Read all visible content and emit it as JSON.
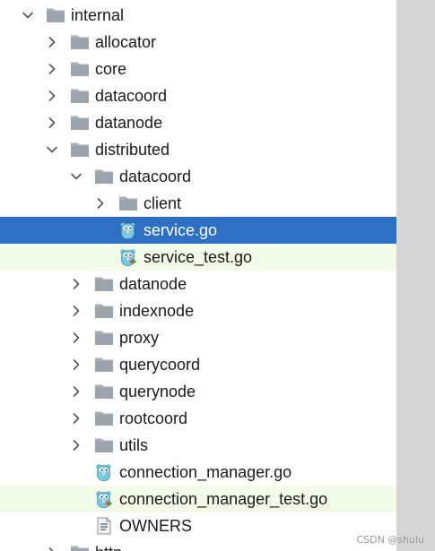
{
  "tree": {
    "items": [
      {
        "label": "internal",
        "type": "folder",
        "depth": 0,
        "expanded": true
      },
      {
        "label": "allocator",
        "type": "folder",
        "depth": 1,
        "expanded": false
      },
      {
        "label": "core",
        "type": "folder",
        "depth": 1,
        "expanded": false
      },
      {
        "label": "datacoord",
        "type": "folder",
        "depth": 1,
        "expanded": false
      },
      {
        "label": "datanode",
        "type": "folder",
        "depth": 1,
        "expanded": false
      },
      {
        "label": "distributed",
        "type": "folder",
        "depth": 1,
        "expanded": true
      },
      {
        "label": "datacoord",
        "type": "folder",
        "depth": 2,
        "expanded": true
      },
      {
        "label": "client",
        "type": "folder",
        "depth": 3,
        "expanded": false
      },
      {
        "label": "service.go",
        "type": "go-file",
        "depth": 3,
        "state": "selected"
      },
      {
        "label": "service_test.go",
        "type": "go-test-file",
        "depth": 3,
        "state": "highlight"
      },
      {
        "label": "datanode",
        "type": "folder",
        "depth": 2,
        "expanded": false
      },
      {
        "label": "indexnode",
        "type": "folder",
        "depth": 2,
        "expanded": false
      },
      {
        "label": "proxy",
        "type": "folder",
        "depth": 2,
        "expanded": false
      },
      {
        "label": "querycoord",
        "type": "folder",
        "depth": 2,
        "expanded": false
      },
      {
        "label": "querynode",
        "type": "folder",
        "depth": 2,
        "expanded": false
      },
      {
        "label": "rootcoord",
        "type": "folder",
        "depth": 2,
        "expanded": false
      },
      {
        "label": "utils",
        "type": "folder",
        "depth": 2,
        "expanded": false
      },
      {
        "label": "connection_manager.go",
        "type": "go-file",
        "depth": 2
      },
      {
        "label": "connection_manager_test.go",
        "type": "go-test-file",
        "depth": 2,
        "state": "highlight"
      },
      {
        "label": "OWNERS",
        "type": "text-file",
        "depth": 2
      },
      {
        "label": "http",
        "type": "folder",
        "depth": 1,
        "expanded": false
      }
    ]
  },
  "watermark": "CSDN @shulu",
  "colors": {
    "selection": "#2d6fc2",
    "highlight": "#f1fbe8",
    "folder": "#a6adb6",
    "scrollbar": "#d6d6d6",
    "gopher": "#79c7e3"
  }
}
